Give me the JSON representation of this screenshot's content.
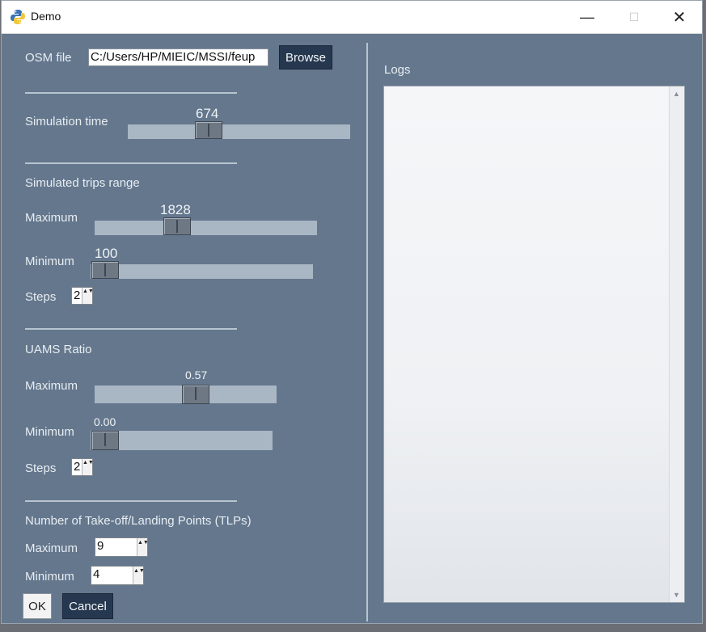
{
  "window": {
    "title": "Demo",
    "minimize": "—",
    "maximize": "☐",
    "close": "✕"
  },
  "osm": {
    "label": "OSM file",
    "value": "C:/Users/HP/MIEIC/MSSI/feup",
    "browse": "Browse"
  },
  "simulation_time": {
    "label": "Simulation time",
    "value": "674"
  },
  "trips": {
    "title": "Simulated trips range",
    "max_label": "Maximum",
    "max_value": "1828",
    "min_label": "Minimum",
    "min_value": "100",
    "steps_label": "Steps",
    "steps_value": "2"
  },
  "uams": {
    "title": "UAMS Ratio",
    "max_label": "Maximum",
    "max_value": "0.57",
    "min_label": "Minimum",
    "min_value": "0.00",
    "steps_label": "Steps",
    "steps_value": "2"
  },
  "tlps": {
    "title": "Number of Take-off/Landing Points (TLPs)",
    "max_label": "Maximum",
    "max_value": "9",
    "min_label": "Minimum",
    "min_value": "4"
  },
  "buttons": {
    "ok": "OK",
    "cancel": "Cancel"
  },
  "logs": {
    "label": "Logs"
  },
  "icons": {
    "app": "python-icon",
    "spin_arrows": "▲▼",
    "scroll_up": "▲",
    "scroll_down": "▼"
  },
  "colors": {
    "panel": "#64778d",
    "button": "#26384f",
    "slider_track": "#a9b6c4"
  }
}
